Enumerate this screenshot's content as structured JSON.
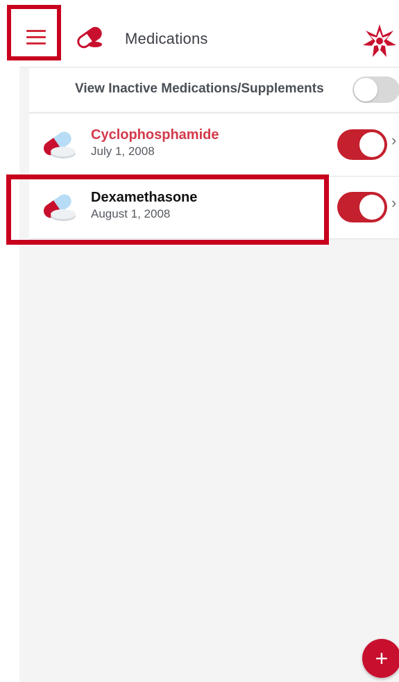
{
  "app_bar": {
    "title": "Medications",
    "menu_icon": "hamburger-menu-icon",
    "title_icon": "pill-capsule-icon",
    "logo_icon": "red-star-logo-icon"
  },
  "filter": {
    "label": "View Inactive Medications/Supplements",
    "enabled": false
  },
  "medications": [
    {
      "name": "Cyclophosphamide",
      "date": "July 1, 2008",
      "active": true,
      "name_color": "#d23a4a"
    },
    {
      "name": "Dexamethasone",
      "date": "August 1, 2008",
      "active": true,
      "name_color": "#111111"
    }
  ],
  "fab": {
    "label": "+"
  },
  "colors": {
    "accent": "#c8102e",
    "highlight": "#c8001e",
    "toggle_on": "#c4202e",
    "toggle_off": "#d8d8d8",
    "background": "#f4f4f4"
  }
}
